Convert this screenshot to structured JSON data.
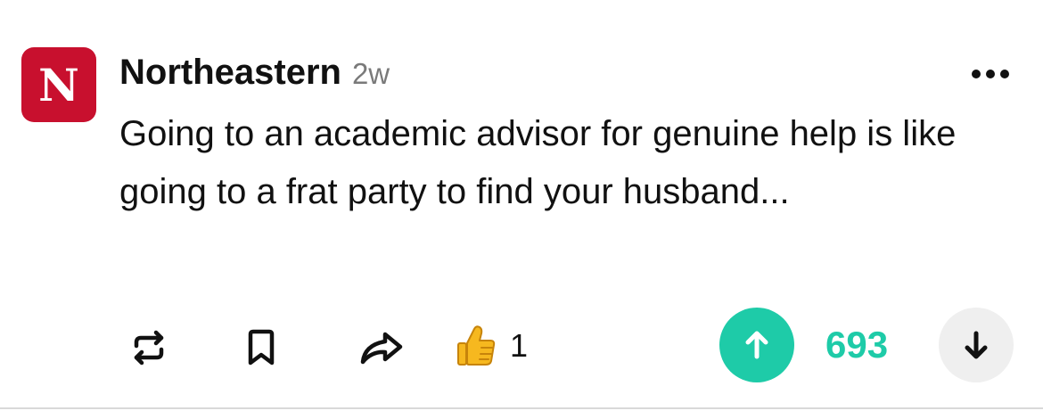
{
  "post": {
    "community": {
      "avatar_letter": "N",
      "avatar_color": "#c8102e",
      "name": "Northeastern"
    },
    "age": "2w",
    "body": "Going to an academic advisor for genuine help is like going to a frat party to find your husband...",
    "menu_icon": "more-horizontal-icon"
  },
  "actions": {
    "repost_icon": "repost-icon",
    "bookmark_icon": "bookmark-icon",
    "share_icon": "share-arrow-icon",
    "reaction": {
      "emoji": "👍",
      "count": "1"
    },
    "votes": {
      "upvote_icon": "arrow-up-icon",
      "downvote_icon": "arrow-down-icon",
      "score": "693",
      "accent_color": "#1ecba8",
      "downvote_bg": "#efefef"
    }
  }
}
